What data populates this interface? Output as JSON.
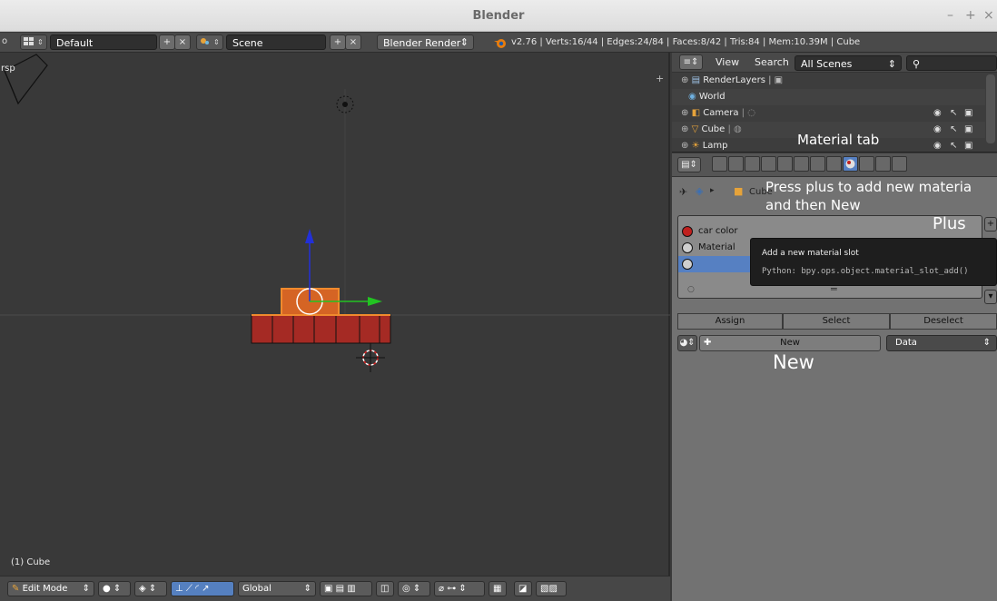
{
  "window": {
    "title": "Blender",
    "controls": [
      "–",
      "+",
      "×"
    ]
  },
  "info_header": {
    "left_cut": "o",
    "screen_layout": "Default",
    "scene": "Scene",
    "render_engine": "Blender Render",
    "stats": "v2.76 | Verts:16/44 | Edges:24/84 | Faces:8/42 | Tris:84 | Mem:10.39M | Cube"
  },
  "viewport": {
    "corner_label": "rsp",
    "object_label": "(1) Cube",
    "header": {
      "mode": "Edit Mode",
      "orientation": "Global"
    }
  },
  "outliner": {
    "view_label": "View",
    "search_label": "Search",
    "filter_value": "All Scenes",
    "rows": [
      {
        "label": "RenderLayers"
      },
      {
        "label": "World"
      },
      {
        "label": "Camera"
      },
      {
        "label": "Cube"
      },
      {
        "label": "Lamp"
      }
    ]
  },
  "properties": {
    "breadcrumb": "Cube",
    "slots": [
      {
        "label": "car color",
        "color": "#c0201e"
      },
      {
        "label": "Material",
        "color": "#cfcfcf"
      },
      {
        "label": "",
        "color": "#cfcfcf"
      }
    ],
    "assign_label": "Assign",
    "select_label": "Select",
    "deselect_label": "Deselect",
    "new_label": "New",
    "link_value": "Data",
    "drag_handle": "═",
    "tooltip": {
      "title": "Add a new material slot",
      "python": "Python: bpy.ops.object.material_slot_add()"
    }
  },
  "annotations": {
    "material_tab": "Material tab",
    "press_plus_line1": "Press plus to add new materia",
    "press_plus_line2": "and then New",
    "plus": "Plus",
    "new": "New"
  },
  "colors": {
    "active_blue": "#5680c2",
    "mesh_red": "#a52a24",
    "selected_orange": "#e2721f"
  }
}
